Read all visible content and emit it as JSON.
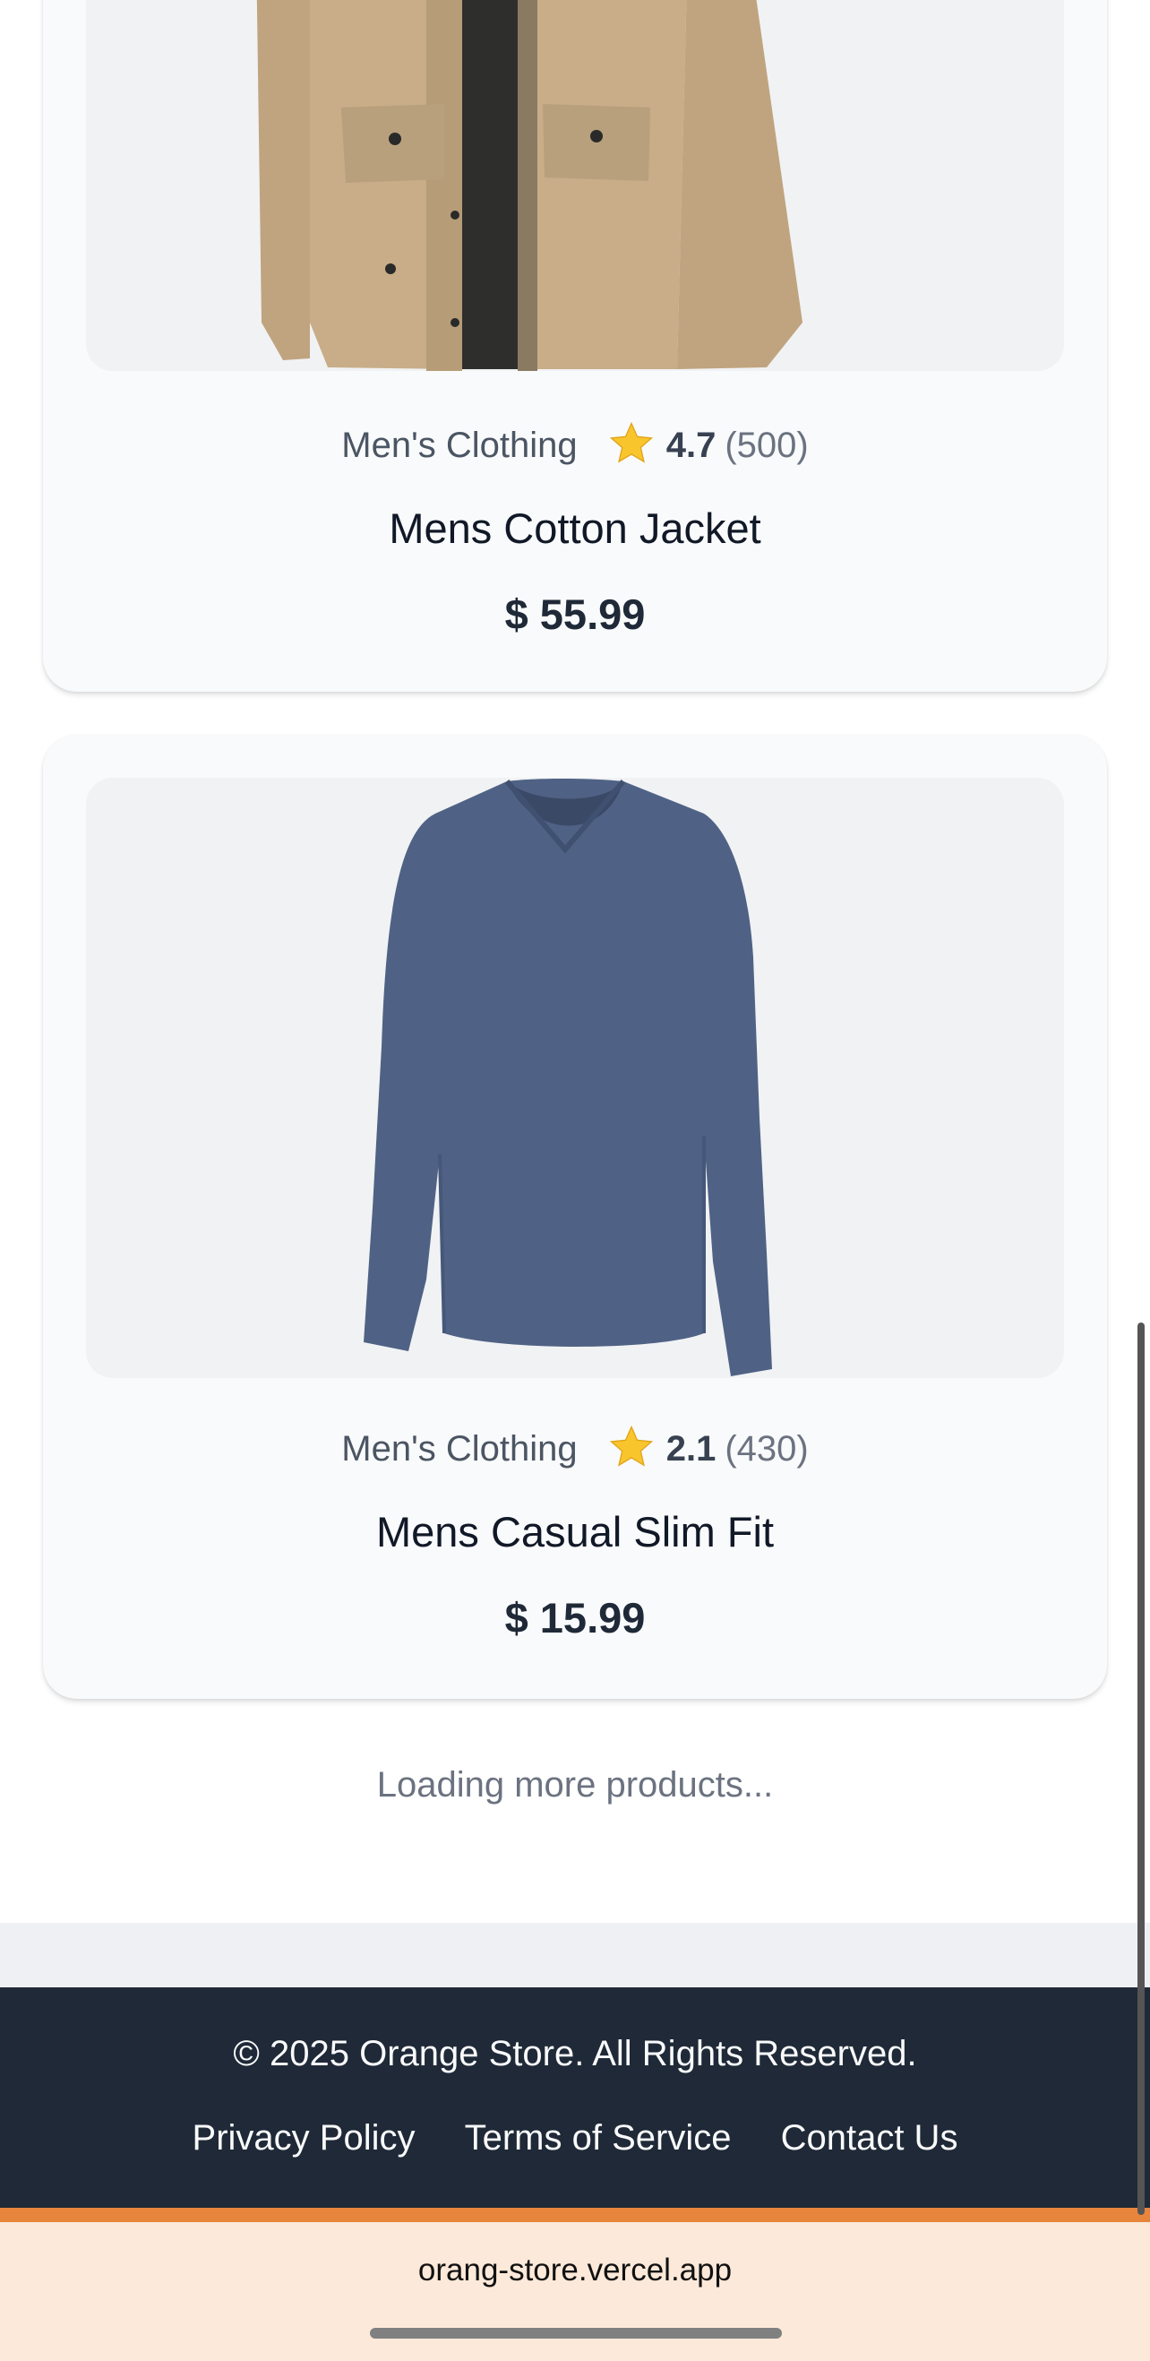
{
  "products": [
    {
      "category": "Men's Clothing",
      "rating": "4.7",
      "count": "(500)",
      "title": "Mens Cotton Jacket",
      "price": "$ 55.99",
      "image_icon": "jacket-image"
    },
    {
      "category": "Men's Clothing",
      "rating": "2.1",
      "count": "(430)",
      "title": "Mens Casual Slim Fit",
      "price": "$ 15.99",
      "image_icon": "long-sleeve-shirt-image"
    }
  ],
  "loading_text": "Loading more products...",
  "footer": {
    "copyright": "© 2025 Orange Store. All Rights Reserved.",
    "links": [
      "Privacy Policy",
      "Terms of Service",
      "Contact Us"
    ]
  },
  "browser": {
    "url": "orang-store.vercel.app"
  },
  "colors": {
    "footer_bg": "#1f2937",
    "accent": "#e8853d",
    "url_bar_bg": "#fce9d9",
    "star": "#f9c52d"
  }
}
